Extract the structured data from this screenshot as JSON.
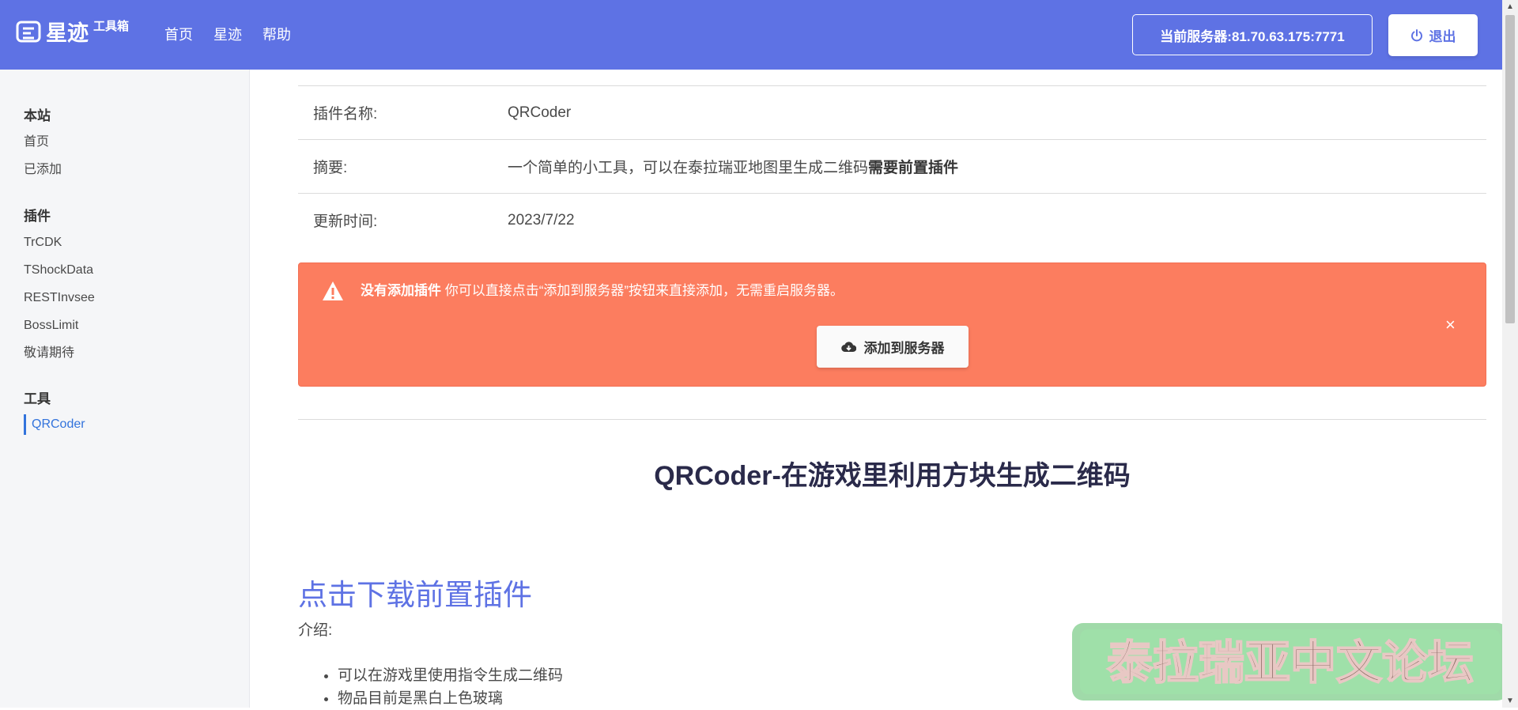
{
  "navbar": {
    "brand_name": "星迹",
    "brand_sub": "工具箱",
    "links": [
      "首页",
      "星迹",
      "帮助"
    ],
    "server_label": "当前服务器:81.70.63.175:7771",
    "logout_label": "退出",
    "logout_icon": "power-icon",
    "color": "#5e72e4"
  },
  "sidebar": {
    "groups": [
      {
        "heading": "本站",
        "items": [
          "首页",
          "已添加"
        ]
      },
      {
        "heading": "插件",
        "items": [
          "TrCDK",
          "TShockData",
          "RESTInvsee",
          "BossLimit",
          "敬请期待"
        ]
      },
      {
        "heading": "工具",
        "items": [
          "QRCoder"
        ]
      }
    ],
    "active_item": "QRCoder"
  },
  "plugin_info": {
    "rows": [
      {
        "label": "插件名称:",
        "value": "QRCoder"
      },
      {
        "label": "摘要:",
        "value": "一个简单的小工具，可以在泰拉瑞亚地图里生成二维码",
        "value_strong": "需要前置插件"
      },
      {
        "label": "更新时间:",
        "value": "2023/7/22"
      }
    ]
  },
  "alert": {
    "title": "没有添加插件",
    "message": " 你可以直接点击“添加到服务器”按钮来直接添加，无需重启服务器。",
    "button_label": "添加到服务器",
    "button_icon": "cloud-download-icon",
    "close": "×",
    "color": "#fc7d5f"
  },
  "doc": {
    "title": "QRCoder-在游戏里利用方块生成二维码",
    "download_link": "点击下载前置插件",
    "intro_label": "介绍:",
    "features": [
      "可以在游戏里使用指令生成二维码",
      "物品目前是黑白上色玻璃"
    ]
  },
  "watermark": {
    "text": "泰拉瑞亚中文论坛"
  }
}
